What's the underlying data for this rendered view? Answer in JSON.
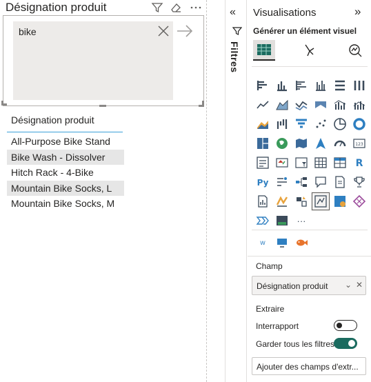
{
  "slicer": {
    "title": "Désignation produit",
    "search_value": "bike",
    "list_header": "Désignation produit",
    "items": [
      "All-Purpose Bike Stand",
      "Bike Wash - Dissolver",
      "Hitch Rack - 4-Bike",
      "Mountain Bike Socks, L",
      "Mountain Bike Socks, M"
    ],
    "header_icons": [
      "filter-icon",
      "eraser-icon",
      "more-options-icon"
    ]
  },
  "filters_pane": {
    "label": "Filtres",
    "expand_glyph": "«"
  },
  "viz_pane": {
    "title": "Visualisations",
    "collapse_glyph": "»",
    "subtitle": "Générer un élément visuel",
    "more_glyph": "···",
    "custom_w": "w",
    "field_section": "Champ",
    "field_value": "Désignation produit",
    "extract_label": "Extraire",
    "cross_report_label": "Interrapport",
    "keep_filters_label": "Garder tous les filtres",
    "add_fields_label": "Ajouter des champs d'extr...",
    "cross_report_on": false,
    "keep_filters_on": true,
    "accent_color": "#1b6b5f"
  }
}
